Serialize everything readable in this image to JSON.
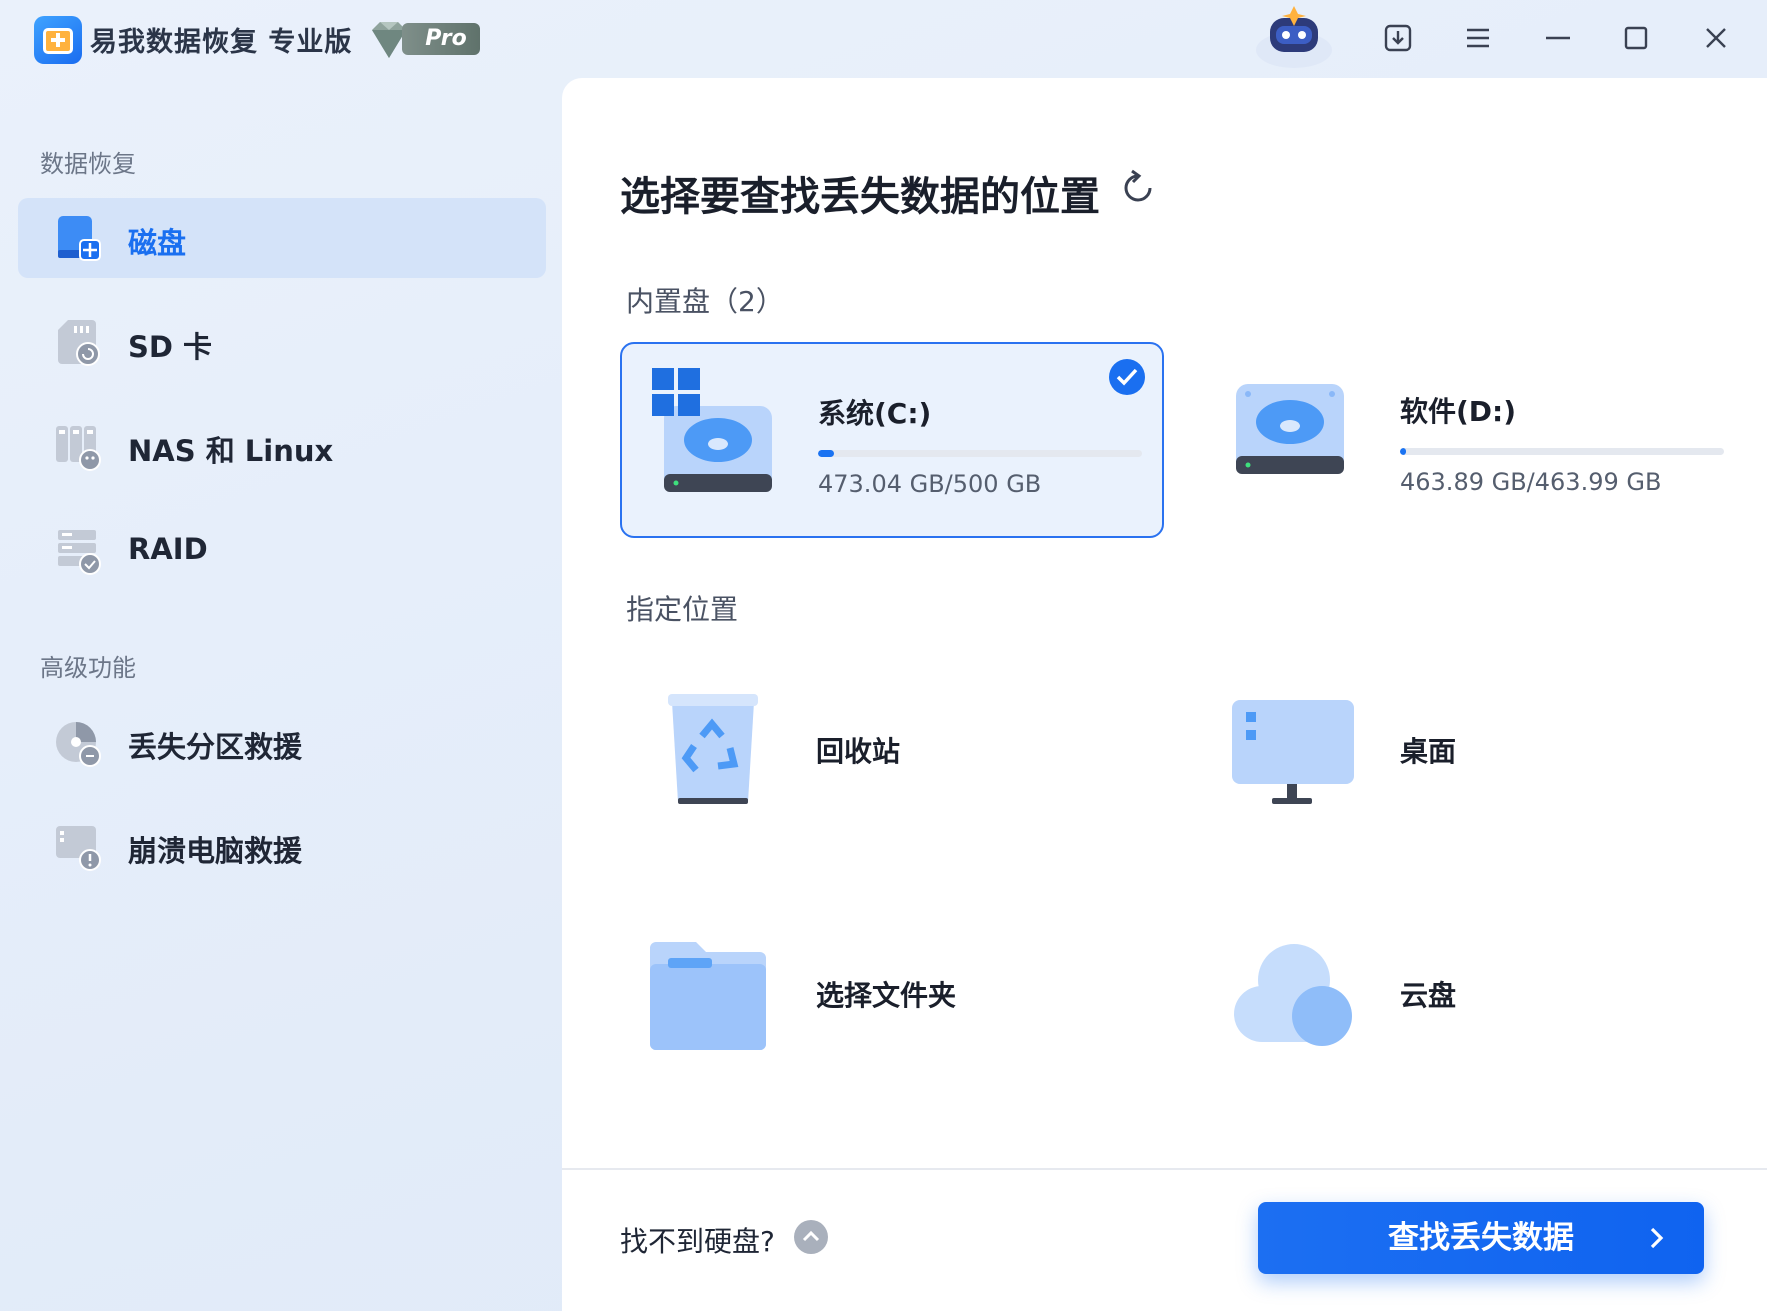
{
  "titlebar": {
    "app_title": "易我数据恢复 专业版",
    "badge": "Pro"
  },
  "sidebar": {
    "section_recovery": "数据恢复",
    "items": [
      {
        "label": "磁盘",
        "icon": "disk-icon",
        "active": true
      },
      {
        "label": "SD 卡",
        "icon": "sd-card-icon",
        "active": false
      },
      {
        "label": "NAS 和 Linux",
        "icon": "nas-icon",
        "active": false
      },
      {
        "label": "RAID",
        "icon": "raid-icon",
        "active": false
      }
    ],
    "section_advanced": "高级功能",
    "advanced_items": [
      {
        "label": "丢失分区救援",
        "icon": "partition-icon"
      },
      {
        "label": "崩溃电脑救援",
        "icon": "crashed-pc-icon"
      }
    ]
  },
  "main": {
    "title": "选择要查找丢失数据的位置",
    "internal_label": "内置盘（2）",
    "drives": [
      {
        "name": "系统(C:)",
        "size": "473.04 GB/500 GB",
        "used_fraction": 0.05,
        "selected": true
      },
      {
        "name": "软件(D:)",
        "size": "463.89 GB/463.99 GB",
        "used_fraction": 0.02,
        "selected": false
      }
    ],
    "location_label": "指定位置",
    "locations": [
      {
        "label": "回收站",
        "icon": "recycle-bin-icon"
      },
      {
        "label": "桌面",
        "icon": "desktop-icon"
      },
      {
        "label": "选择文件夹",
        "icon": "folder-icon"
      },
      {
        "label": "云盘",
        "icon": "cloud-icon"
      }
    ],
    "help_text": "找不到硬盘?",
    "scan_button": "查找丢失数据"
  },
  "colors": {
    "accent": "#1a6ff0",
    "active_nav_bg": "#d4e3f9",
    "selected_card_bg": "#eaf2fd"
  }
}
